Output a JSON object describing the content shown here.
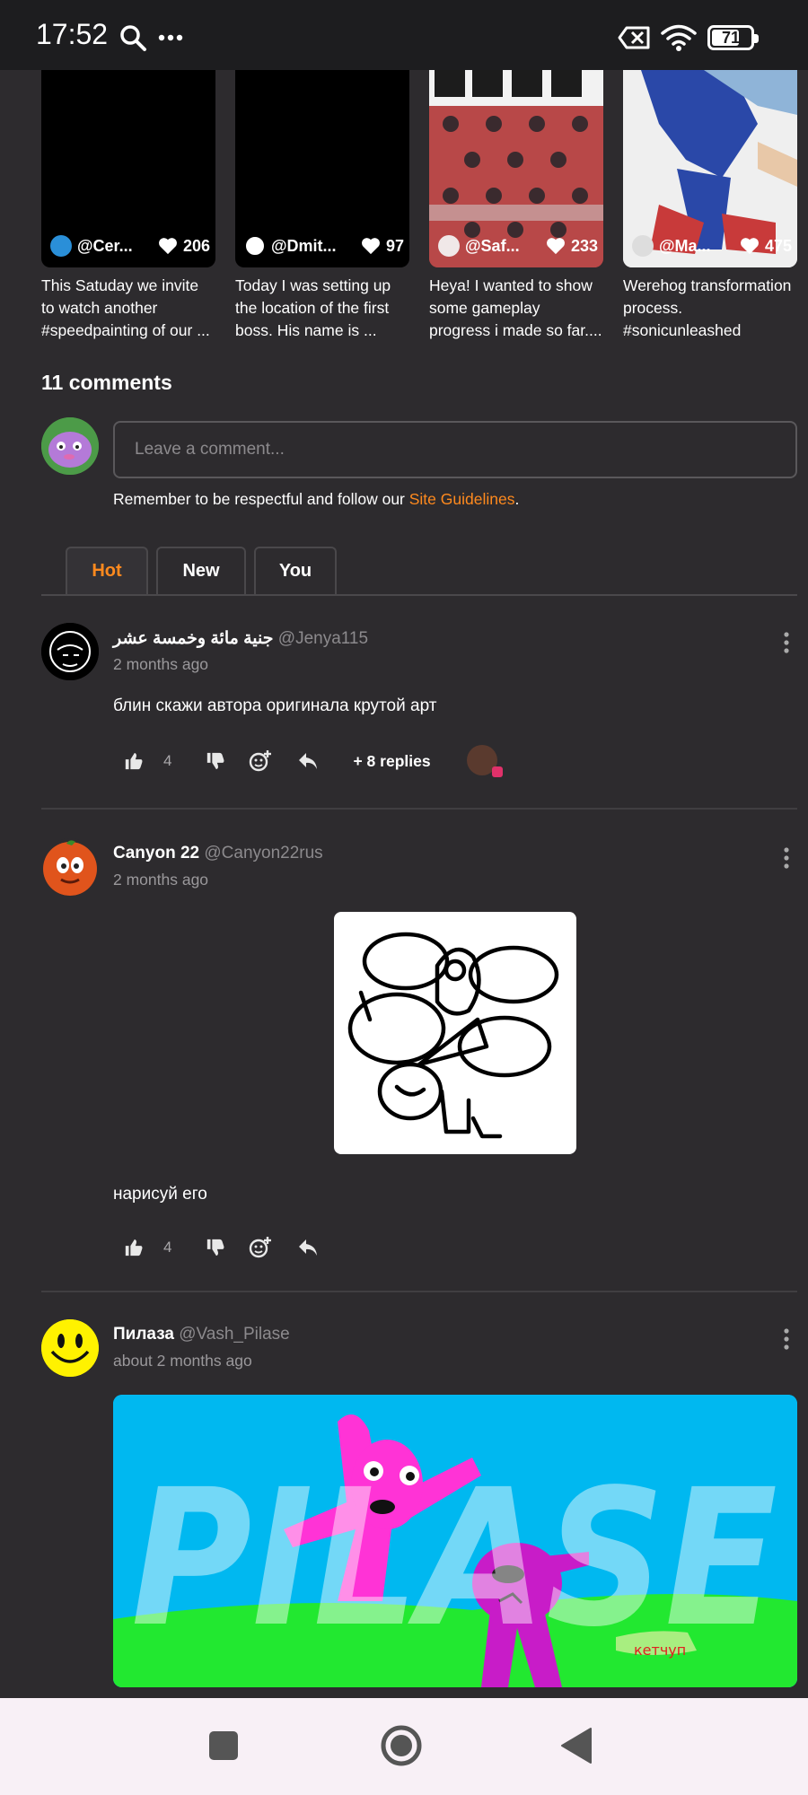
{
  "status_bar": {
    "time": "17:52",
    "battery_level": "71",
    "battery_fraction": 0.71,
    "icons": [
      "search-icon",
      "more-dots-icon",
      "data-off-icon",
      "wifi-icon",
      "battery-icon"
    ]
  },
  "related_videos": [
    {
      "username": "@Cer...",
      "likes": "206",
      "desc": "This Satuday we invite to watch another #speedpainting of our ..."
    },
    {
      "username": "@Dmit...",
      "likes": "97",
      "desc": "Today I was setting up the location of the first boss. His name is ..."
    },
    {
      "username": "@Saf...",
      "likes": "233",
      "desc": "Heya! I wanted to show some gameplay progress i made so far...."
    },
    {
      "username": "@Ma...",
      "likes": "475",
      "desc": "Werehog transformation process. #sonicunleashed"
    }
  ],
  "comments_section": {
    "title": "11 comments",
    "input_placeholder": "Leave a comment...",
    "guidelines_prefix": "Remember to be respectful and follow our ",
    "guidelines_link": "Site Guidelines",
    "guidelines_suffix": ".",
    "tabs": [
      {
        "label": "Hot"
      },
      {
        "label": "New"
      },
      {
        "label": "You"
      }
    ],
    "active_tab": "Hot"
  },
  "comments": [
    {
      "name": "جنية مائة وخمسة عشر",
      "handle": "@Jenya115",
      "time": "2 months ago",
      "text": "блин скажи автора оригинала крутой арт",
      "likes": "4",
      "replies": "+ 8 replies"
    },
    {
      "name": "Canyon 22",
      "handle": "@Canyon22rus",
      "time": "2 months ago",
      "text": "нарисуй его",
      "likes": "4"
    },
    {
      "name": "Пилаза",
      "handle": "@Vash_Pilase",
      "time": "about 2 months ago",
      "image_text": "PILASE",
      "signature": "кетчуп"
    }
  ],
  "colors": {
    "background": "#2d2b2e",
    "accent": "#ff8a1e",
    "status_bar": "#1d1d1f",
    "nav_bar": "#f8f0f6"
  },
  "nav_icons": [
    "recents-square-icon",
    "home-circle-icon",
    "back-triangle-icon"
  ]
}
